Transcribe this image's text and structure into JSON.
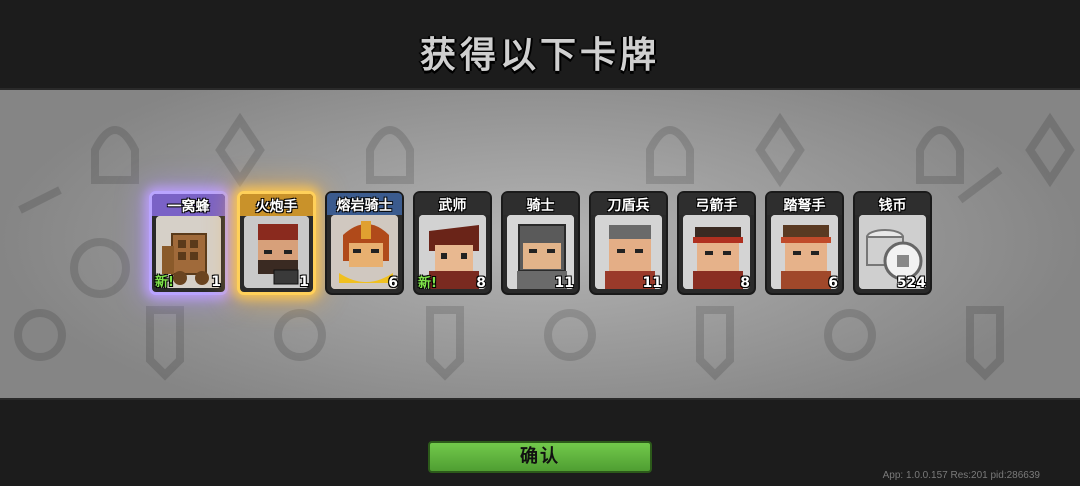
{
  "title": "获得以下卡牌",
  "cards": [
    {
      "name": "一窝蜂",
      "count": "1",
      "new": "新!",
      "rarity": "epic",
      "icon": "wooden-rocket-cart-icon"
    },
    {
      "name": "火炮手",
      "count": "1",
      "new": "",
      "rarity": "legendary",
      "icon": "cannoneer-icon"
    },
    {
      "name": "熔岩骑士",
      "count": "6",
      "new": "",
      "rarity": "rare",
      "icon": "lava-knight-icon"
    },
    {
      "name": "武师",
      "count": "8",
      "new": "新!",
      "rarity": "common",
      "icon": "martial-master-icon"
    },
    {
      "name": "骑士",
      "count": "11",
      "new": "",
      "rarity": "common",
      "icon": "knight-icon"
    },
    {
      "name": "刀盾兵",
      "count": "11",
      "new": "",
      "rarity": "common",
      "icon": "sword-shield-soldier-icon"
    },
    {
      "name": "弓箭手",
      "count": "8",
      "new": "",
      "rarity": "common",
      "icon": "archer-icon"
    },
    {
      "name": "踏弩手",
      "count": "6",
      "new": "",
      "rarity": "common",
      "icon": "crossbowman-icon"
    },
    {
      "name": "钱币",
      "count": "524",
      "new": "",
      "rarity": "common",
      "icon": "coin-stack-icon"
    }
  ],
  "confirm_label": "确认",
  "footer": "App: 1.0.0.157 Res:201 pid:286639",
  "colors": {
    "epic_glow": "#b9a4ff",
    "legendary_glow": "#ffd05a",
    "confirm_button": "#5fb33e",
    "new_badge": "#7ee34a"
  }
}
